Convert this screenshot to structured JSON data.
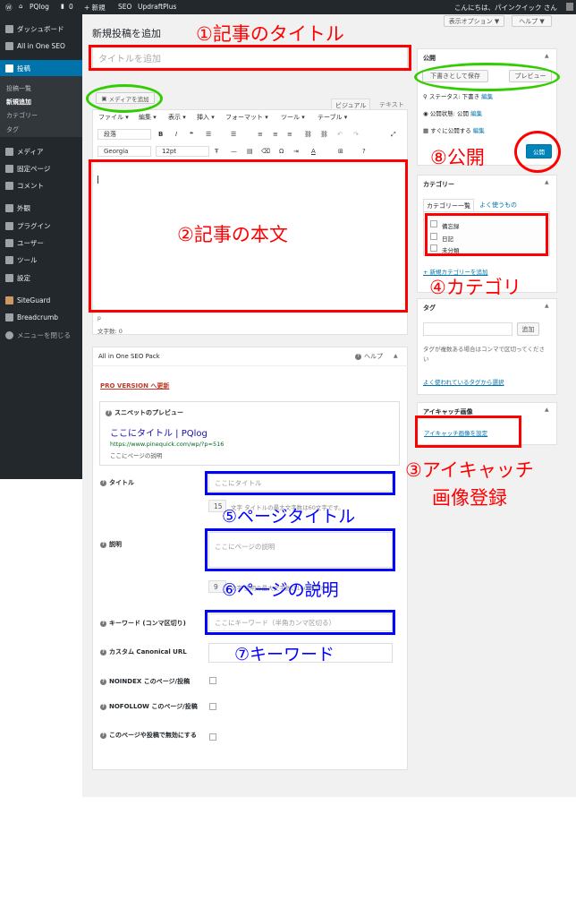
{
  "adminbar": {
    "site": "PQlog",
    "comments": "0",
    "new": "+ 新規",
    "seo": "SEO",
    "updraft": "UpdraftPlus",
    "greeting": "こんにちは、パインクイック さん"
  },
  "sidebar": {
    "dashboard": "ダッシュボード",
    "aioseo": "All in One SEO",
    "posts": "投稿",
    "post_list": "投稿一覧",
    "new_post": "新規追加",
    "categories": "カテゴリー",
    "tags": "タグ",
    "media": "メディア",
    "pages": "固定ページ",
    "comments": "コメント",
    "appearance": "外観",
    "plugins": "プラグイン",
    "users": "ユーザー",
    "tools": "ツール",
    "settings": "設定",
    "siteguard": "SiteGuard",
    "breadcrumb": "Breadcrumb",
    "collapse": "メニューを閉じる"
  },
  "screen": {
    "options": "表示オプション ▼",
    "help": "ヘルプ ▼"
  },
  "editor": {
    "heading": "新規投稿を追加",
    "title_placeholder": "タイトルを追加",
    "add_media": "メディアを追加",
    "tab_visual": "ビジュアル",
    "tab_text": "テキスト",
    "menu": [
      "ファイル ▾",
      "編集 ▾",
      "表示 ▾",
      "挿入 ▾",
      "フォーマット ▾",
      "ツール ▾",
      "テーブル ▾"
    ],
    "block_format": "段落",
    "font_family": "Georgia",
    "font_size": "12pt",
    "path": "p",
    "word_count": "文字数: 0"
  },
  "publish": {
    "title": "公開",
    "save_draft": "下書きとして保存",
    "preview": "プレビュー",
    "status": "ステータス: 下書き",
    "status_edit": "編集",
    "visibility": "公開状態: 公開",
    "visibility_edit": "編集",
    "schedule": "すぐに公開する",
    "schedule_edit": "編集",
    "button": "公開"
  },
  "categories_box": {
    "title": "カテゴリー",
    "tab_all": "カテゴリー一覧",
    "tab_popular": "よく使うもの",
    "items": [
      "備忘録",
      "日記",
      "未分類"
    ],
    "add_new": "+ 新規カテゴリーを追加"
  },
  "tags_box": {
    "title": "タグ",
    "add": "追加",
    "hint": "タグが複数ある場合はコンマで区切ってください",
    "popular": "よく使われているタグから選択"
  },
  "featured": {
    "title": "アイキャッチ画像",
    "set": "アイキャッチ画像を設定"
  },
  "aioseo": {
    "title": "All in One SEO Pack",
    "help": "ヘルプ",
    "pro": "PRO VERSION へ更新",
    "snippet_label": "スニペットのプレビュー",
    "snippet_title": "ここにタイトル | PQlog",
    "snippet_url": "https://www.pinequick.com/wp/?p=516",
    "snippet_desc": "ここにページの説明",
    "title_label": "タイトル",
    "title_placeholder": "ここにタイトル",
    "title_count": "15",
    "title_count_text": "文字 タイトルの最大文字数は60文字です。",
    "desc_label": "説明",
    "desc_placeholder": "ここにページの説明",
    "desc_count": "9",
    "desc_count_text": "文字 説明の最大文字数は160文字です。",
    "keywords_label": "キーワード (コンマ区切り)",
    "keywords_placeholder": "ここにキーワード（半角カンマ区切る）",
    "canonical_label": "カスタム Canonical URL",
    "noindex_label": "NOINDEX このページ/投稿",
    "nofollow_label": "NOFOLLOW このページ/投稿",
    "disable_label": "このページや投稿で無効にする"
  },
  "annotations": {
    "a1": "①記事のタイトル",
    "a2": "②記事の本文",
    "a3": "③アイキャッチ",
    "a3b": "画像登録",
    "a4": "④カテゴリ",
    "a5": "⑤ページタイトル",
    "a6": "⑥ページの説明",
    "a7": "⑦キーワード",
    "a8": "⑧公開"
  },
  "colors": {
    "annotation_red": "#ff0000",
    "annotation_blue": "#0000ff",
    "annotation_green": "#33cc00",
    "primary_button": "#0085ba",
    "admin_bar": "#23282d"
  }
}
